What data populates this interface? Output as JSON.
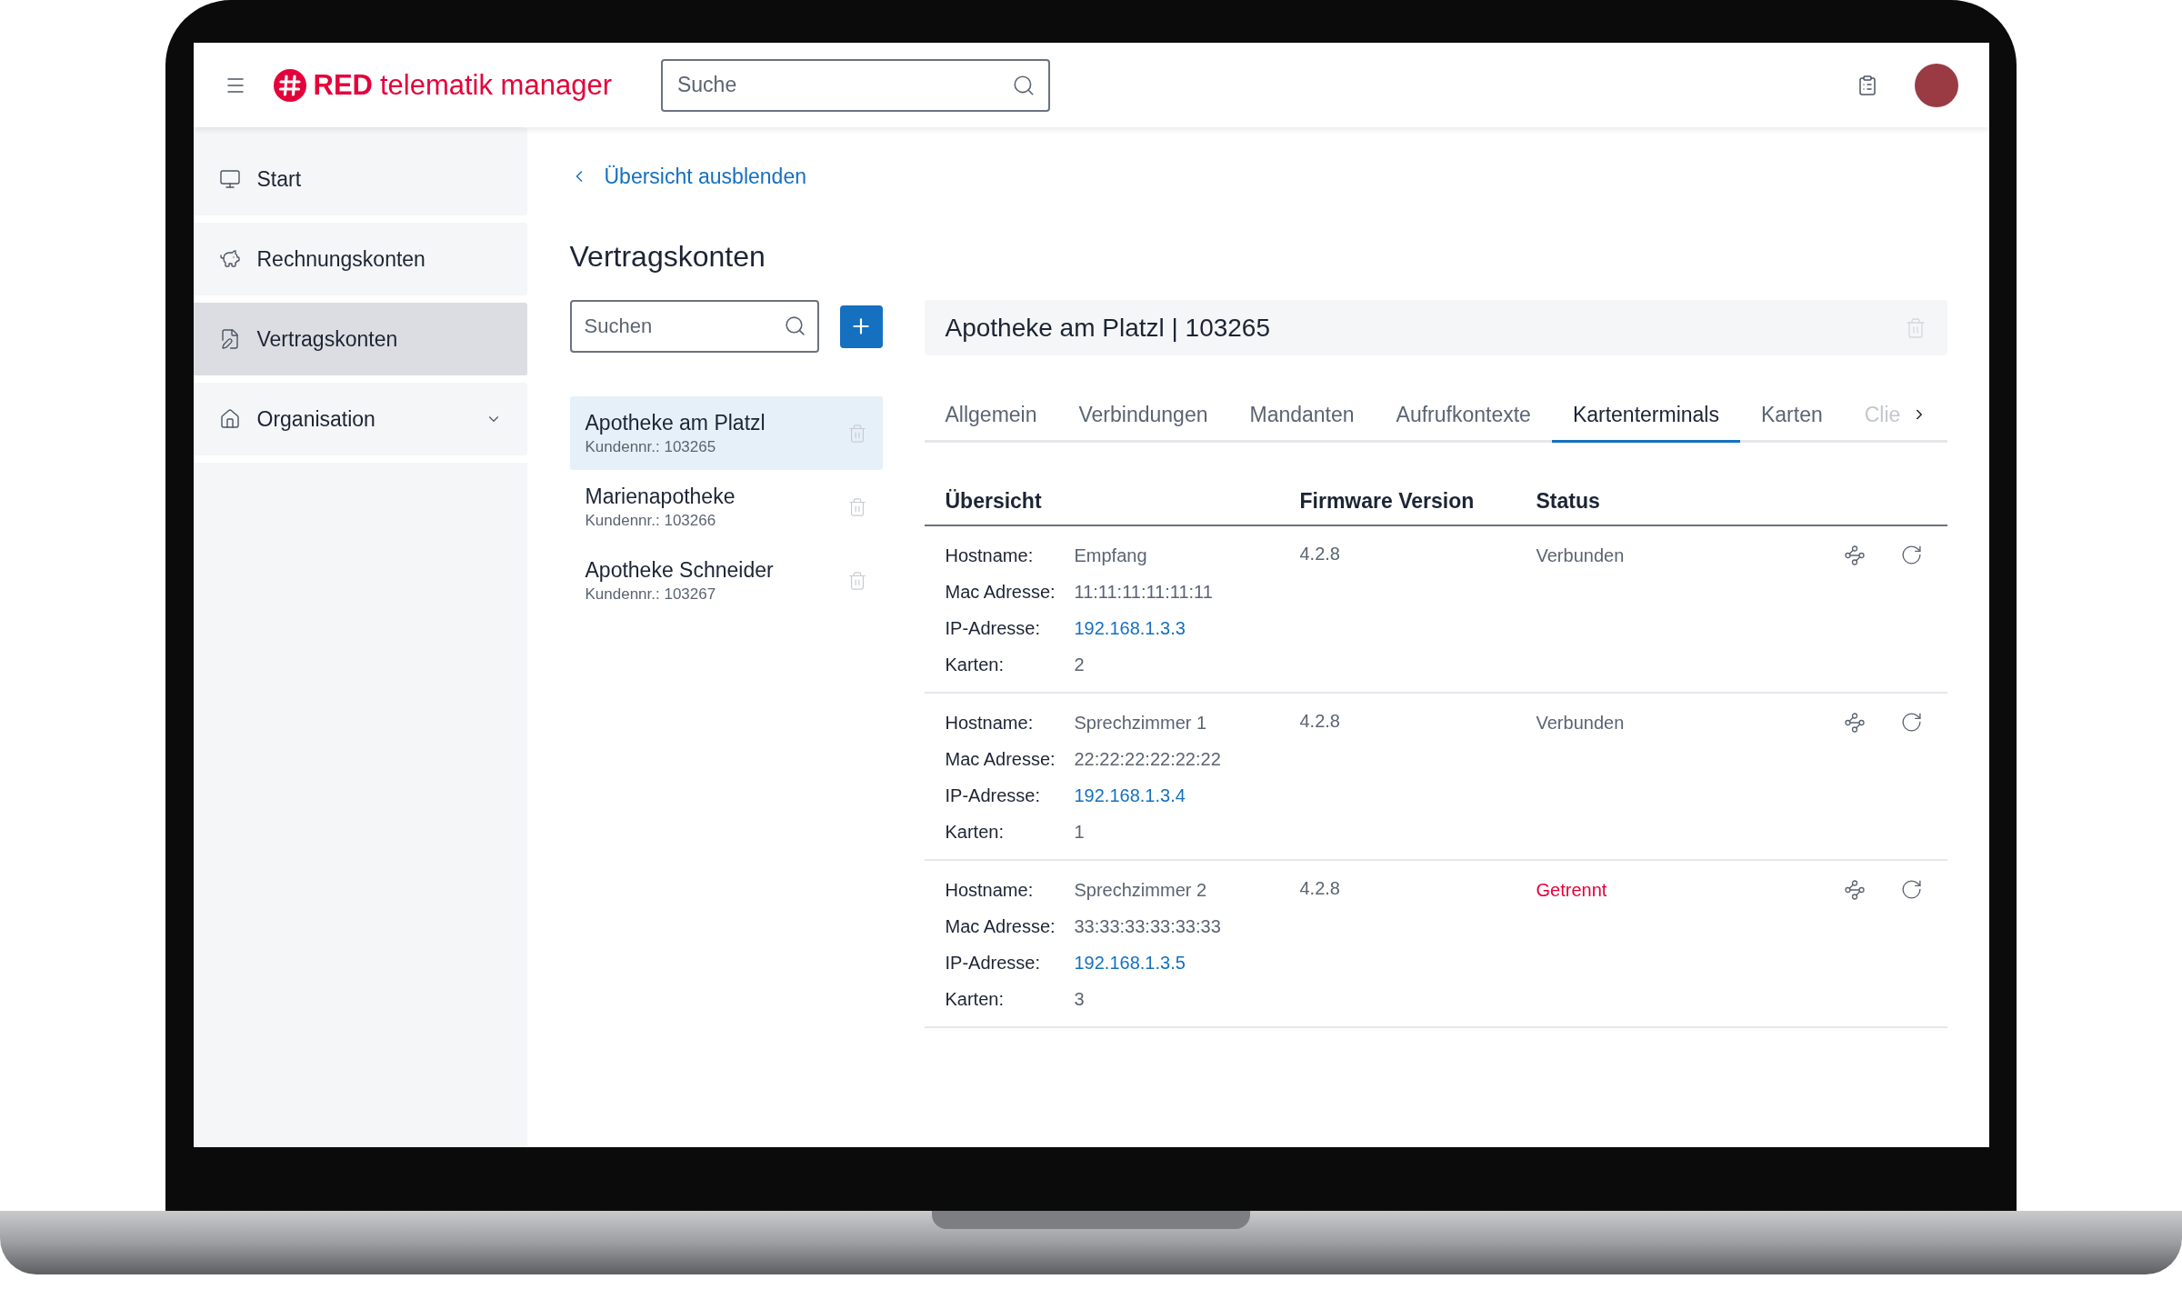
{
  "header": {
    "logo": {
      "brand": "RED",
      "product": "telematik manager"
    },
    "search": {
      "placeholder": "Suche"
    }
  },
  "sidebar": {
    "items": [
      {
        "label": "Start",
        "kind": "link",
        "selected": false
      },
      {
        "label": "Rechnungskonten",
        "kind": "link",
        "selected": false
      },
      {
        "label": "Vertragskonten",
        "kind": "link",
        "selected": true
      },
      {
        "label": "Organisation",
        "kind": "group",
        "selected": false
      }
    ]
  },
  "back_link": "Übersicht ausblenden",
  "title": "Vertragskonten",
  "list": {
    "search": {
      "placeholder": "Suchen"
    },
    "items": [
      {
        "name": "Apotheke am Platzl",
        "number": "Kundennr.: 103265",
        "selected": true
      },
      {
        "name": "Marienapotheke",
        "number": "Kundennr.: 103266",
        "selected": false
      },
      {
        "name": "Apotheke Schneider",
        "number": "Kundennr.: 103267",
        "selected": false
      }
    ]
  },
  "detail": {
    "title": "Apotheke am Platzl | 103265",
    "tabs": [
      {
        "label": "Allgemein",
        "selected": false
      },
      {
        "label": "Verbindungen",
        "selected": false
      },
      {
        "label": "Mandanten",
        "selected": false
      },
      {
        "label": "Aufrufkontexte",
        "selected": false
      },
      {
        "label": "Kartenterminals",
        "selected": true
      },
      {
        "label": "Karten",
        "selected": false
      },
      {
        "label": "Clie",
        "selected": false
      }
    ],
    "table": {
      "columns": [
        "Übersicht",
        "Firmware Version",
        "Status"
      ],
      "rows": [
        {
          "fields": [
            {
              "label": "Hostname:",
              "value": "Empfang",
              "kind": "text"
            },
            {
              "label": "Mac Adresse:",
              "value": "11:11:11:11:11:11",
              "kind": "text"
            },
            {
              "label": "IP-Adresse:",
              "value": "192.168.1.3.3",
              "kind": "link"
            },
            {
              "label": "Karten:",
              "value": "2",
              "kind": "text"
            }
          ],
          "firmware": "4.2.8",
          "status": "Verbunden",
          "connected": true
        },
        {
          "fields": [
            {
              "label": "Hostname:",
              "value": "Sprechzimmer 1",
              "kind": "text"
            },
            {
              "label": "Mac Adresse:",
              "value": "22:22:22:22:22:22",
              "kind": "text"
            },
            {
              "label": "IP-Adresse:",
              "value": "192.168.1.3.4",
              "kind": "link"
            },
            {
              "label": "Karten:",
              "value": "1",
              "kind": "text"
            }
          ],
          "firmware": "4.2.8",
          "status": "Verbunden",
          "connected": true
        },
        {
          "fields": [
            {
              "label": "Hostname:",
              "value": "Sprechzimmer 2",
              "kind": "text"
            },
            {
              "label": "Mac Adresse:",
              "value": "33:33:33:33:33:33",
              "kind": "text"
            },
            {
              "label": "IP-Adresse:",
              "value": "192.168.1.3.5",
              "kind": "link"
            },
            {
              "label": "Karten:",
              "value": "3",
              "kind": "text"
            }
          ],
          "firmware": "4.2.8",
          "status": "Getrennt",
          "connected": false
        }
      ]
    }
  }
}
